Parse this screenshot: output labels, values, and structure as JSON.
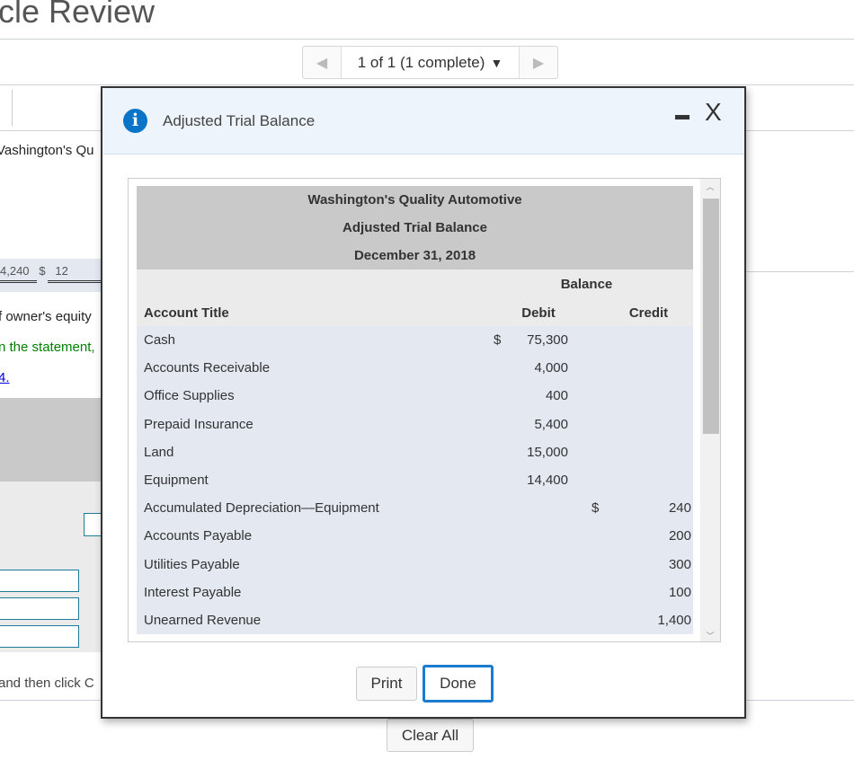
{
  "page": {
    "title": "cle Review",
    "pager": "1 of 1 (1 complete)",
    "bg_company": "Vashington's Qu",
    "bg_ticks": "4,240   $   12",
    "bg_text1": "f owner's equity",
    "bg_text2": "n the statement,",
    "bg_link": "4.",
    "bg_text3": "and then click C",
    "clear_all": "Clear All"
  },
  "modal": {
    "title": "Adjusted Trial Balance",
    "minimize": "minimize",
    "close": "X",
    "company": "Washington's Quality Automotive",
    "report": "Adjusted Trial Balance",
    "date": "December 31, 2018",
    "balance_header": "Balance",
    "col_account": "Account Title",
    "col_debit": "Debit",
    "col_credit": "Credit",
    "rows": [
      {
        "account": "Cash",
        "debit_sign": "$",
        "debit": "75,300",
        "credit_sign": "",
        "credit": ""
      },
      {
        "account": "Accounts Receivable",
        "debit_sign": "",
        "debit": "4,000",
        "credit_sign": "",
        "credit": ""
      },
      {
        "account": "Office Supplies",
        "debit_sign": "",
        "debit": "400",
        "credit_sign": "",
        "credit": ""
      },
      {
        "account": "Prepaid Insurance",
        "debit_sign": "",
        "debit": "5,400",
        "credit_sign": "",
        "credit": ""
      },
      {
        "account": "Land",
        "debit_sign": "",
        "debit": "15,000",
        "credit_sign": "",
        "credit": ""
      },
      {
        "account": "Equipment",
        "debit_sign": "",
        "debit": "14,400",
        "credit_sign": "",
        "credit": ""
      },
      {
        "account": "Accumulated Depreciation—Equipment",
        "debit_sign": "",
        "debit": "",
        "credit_sign": "$",
        "credit": "240"
      },
      {
        "account": "Accounts Payable",
        "debit_sign": "",
        "debit": "",
        "credit_sign": "",
        "credit": "200"
      },
      {
        "account": "Utilities Payable",
        "debit_sign": "",
        "debit": "",
        "credit_sign": "",
        "credit": "300"
      },
      {
        "account": "Interest Payable",
        "debit_sign": "",
        "debit": "",
        "credit_sign": "",
        "credit": "100"
      },
      {
        "account": "Unearned Revenue",
        "debit_sign": "",
        "debit": "",
        "credit_sign": "",
        "credit": "1,400"
      }
    ],
    "print": "Print",
    "done": "Done"
  },
  "colors": {
    "accent": "#0a74c8",
    "done_border": "#1a7bd0",
    "link": "#0000ee",
    "green": "#008000"
  }
}
